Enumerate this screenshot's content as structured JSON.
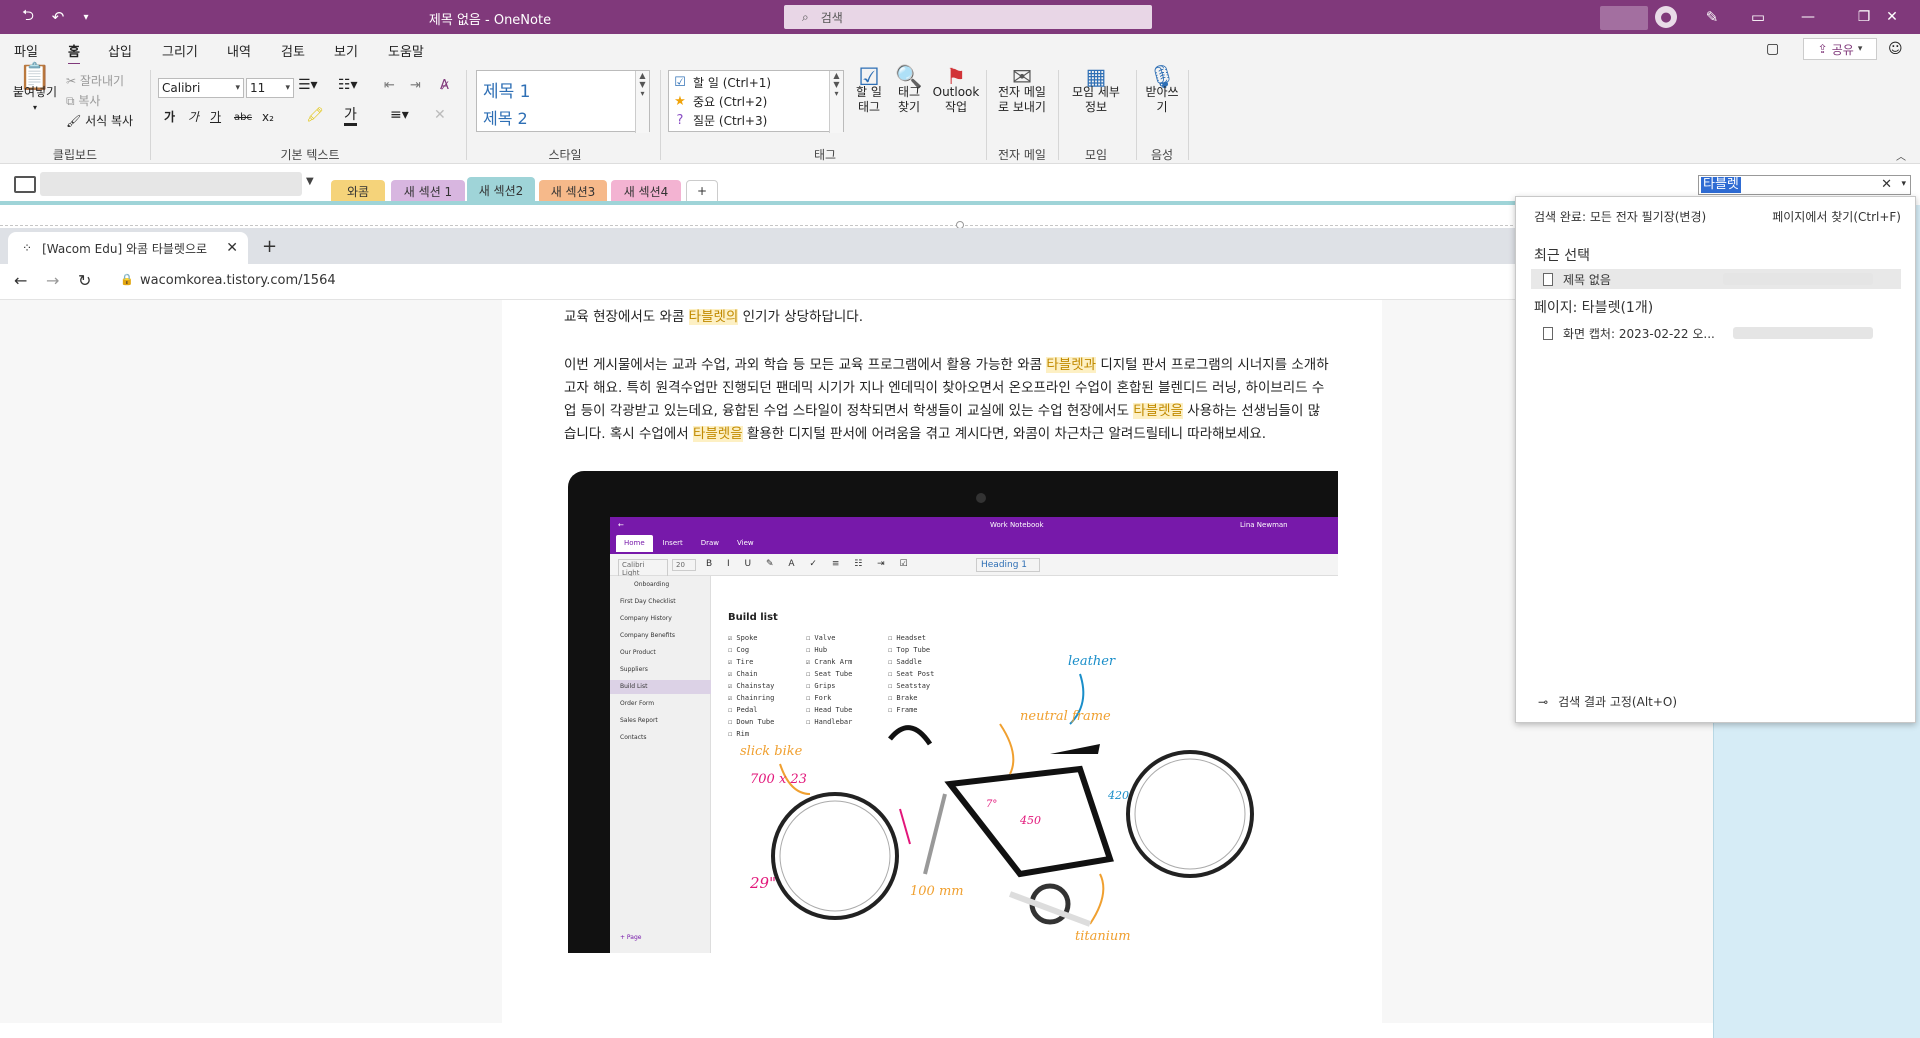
{
  "window": {
    "title": "제목 없음 - OneNote",
    "search_placeholder": "검색"
  },
  "menubar": {
    "items": [
      "파일",
      "홈",
      "삽입",
      "그리기",
      "내역",
      "검토",
      "보기",
      "도움말"
    ],
    "active": "홈",
    "share_label": "공유"
  },
  "ribbon": {
    "clipboard": {
      "paste": "붙여넣기",
      "cut": "잘라내기",
      "copy": "복사",
      "format_painter": "서식 복사",
      "group": "클립보드"
    },
    "basic_text": {
      "font": "Calibri",
      "size": "11",
      "bold": "가",
      "italic": "가",
      "underline": "가",
      "strike": "abc",
      "subscript": "x₂",
      "group": "기본 텍스트"
    },
    "styles": {
      "h1": "제목 1",
      "h2": "제목 2",
      "group": "스타일"
    },
    "tags": {
      "items": [
        "할 일 (Ctrl+1)",
        "중요 (Ctrl+2)",
        "질문 (Ctrl+3)"
      ],
      "todo_tag": "할 일 태그",
      "find_tags": "태그 찾기",
      "outlook": "Outlook 작업",
      "group": "태그"
    },
    "email": {
      "send": "전자 메일로 보내기",
      "group": "전자 메일"
    },
    "meetings": {
      "details": "모임 세부 정보",
      "group": "모임"
    },
    "voice": {
      "dictate": "받아쓰기",
      "group": "음성"
    }
  },
  "sections": [
    {
      "label": "와콤",
      "color": "#f5d37a"
    },
    {
      "label": "새 섹션 1",
      "color": "#d8b6e0"
    },
    {
      "label": "새 섹션2",
      "color": "#9fd4d8"
    },
    {
      "label": "새 섹션3",
      "color": "#f6b98a"
    },
    {
      "label": "새 섹션4",
      "color": "#f3b3d2"
    }
  ],
  "add_section": "+",
  "find": {
    "query": "타블렛",
    "status": "검색 완료: 모든 전자 필기장(변경)",
    "find_on_page": "페이지에서 찾기(Ctrl+F)",
    "recent_heading": "최근 선택",
    "recent_items": [
      "제목 없음"
    ],
    "pages_heading": "페이지: 타블렛(1개)",
    "page_results": [
      "화면 캡처: 2023-02-22 오..."
    ],
    "pin_label": "검색 결과 고정(Alt+O)"
  },
  "browser": {
    "tab_title": "[Wacom Edu] 와콤 타블렛으로 ",
    "url": "wacomkorea.tistory.com/1564"
  },
  "article": {
    "p1": [
      "교육 현장에서도 와콤 ",
      "타블렛의",
      " 인기가 상당하답니다."
    ],
    "p2_lines": [
      [
        "이번 게시물에서는 교과 수업, 과외 학습 등 모든 교육 프로그램에서 활용 가능한 와콤 ",
        "타블렛과",
        " 디지털 판서 프로그램의 시너지를 소개하"
      ],
      [
        "고자 해요. 특히 원격수업만 진행되던 팬데믹 시기가 지나 엔데믹이 찾아오면서 온오프라인 수업이 혼합된 블렌디드 러닝, 하이브리드 수",
        "",
        ""
      ],
      [
        "업 등이 각광받고 있는데요, 융합된 수업 스타일이 정착되면서 학생들이 교실에 있는 수업 현장에서도 ",
        "타블렛을",
        " 사용하는 선생님들이 많"
      ],
      [
        "습니다. 혹시 수업에서 ",
        "타블렛을",
        " 활용한 디지털 판서에 어려움을 겪고 계시다면, 와콤이 차근차근 알려드릴테니 따라해보세요."
      ]
    ]
  },
  "inner_app": {
    "title": "Work Notebook",
    "user": "Lina Newman",
    "tabs": [
      "Home",
      "Insert",
      "Draw",
      "View"
    ],
    "font": "Calibri Light",
    "size": "20",
    "style": "Heading 1",
    "section": "Onboarding",
    "pages": [
      "First Day Checklist",
      "Company History",
      "Company Benefits",
      "Our Product",
      "Suppliers",
      "Build List",
      "Order Form",
      "Sales Report",
      "Contacts"
    ],
    "selected_page": "Build List",
    "add_page": "+ Page",
    "heading": "Build list",
    "col1": [
      "☑ Spoke",
      "☐ Cog",
      "☑ Tire",
      "☑ Chain",
      "☑ Chainstay",
      "☑ Chainring",
      "☐ Pedal",
      "☐ Down Tube",
      "☐ Rim"
    ],
    "col2": [
      "☐ Valve",
      "☐ Hub",
      "☑ Crank Arm",
      "☐ Seat Tube",
      "☐ Grips",
      "☐ Fork",
      "☐ Head Tube",
      "☐ Handlebar"
    ],
    "col3": [
      "☐ Headset",
      "☐ Top Tube",
      "☐ Saddle",
      "☐ Seat Post",
      "☐ Seatstay",
      "☐ Brake",
      "☐ Frame"
    ],
    "notes": [
      "leather",
      "neutral frame",
      "slick bike",
      "700 x 23",
      "29\"",
      "100 mm",
      "titanium",
      "450",
      "420",
      "7°"
    ]
  },
  "colors": {
    "onenote_purple": "#80397b",
    "find_highlight": "#2f6cd3",
    "text_highlight": "#fdf0c4"
  }
}
